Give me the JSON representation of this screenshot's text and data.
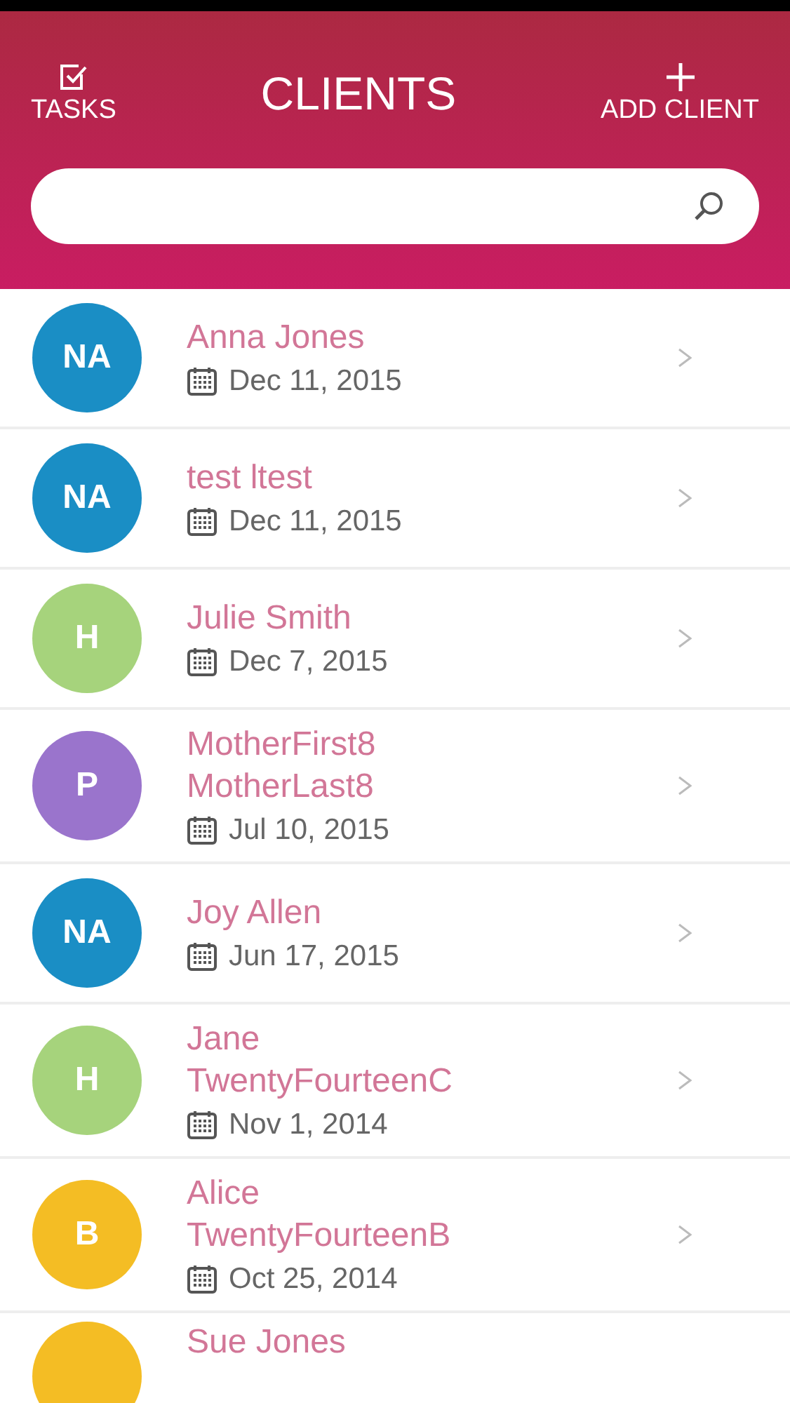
{
  "header": {
    "left_action": "TASKS",
    "title": "CLIENTS",
    "right_action": "ADD CLIENT"
  },
  "clients": [
    {
      "initials": "NA",
      "color": "#1a8ec5",
      "name_lines": [
        "Anna Jones"
      ],
      "date": "Dec 11, 2015"
    },
    {
      "initials": "NA",
      "color": "#1a8ec5",
      "name_lines": [
        "test ltest"
      ],
      "date": "Dec 11, 2015"
    },
    {
      "initials": "H",
      "color": "#a6d37c",
      "name_lines": [
        "Julie Smith"
      ],
      "date": "Dec 7, 2015"
    },
    {
      "initials": "P",
      "color": "#9a74cc",
      "name_lines": [
        "MotherFirst8",
        "MotherLast8"
      ],
      "date": "Jul 10, 2015"
    },
    {
      "initials": "NA",
      "color": "#1a8ec5",
      "name_lines": [
        "Joy Allen"
      ],
      "date": "Jun 17, 2015"
    },
    {
      "initials": "H",
      "color": "#a6d37c",
      "name_lines": [
        "Jane",
        "TwentyFourteenC"
      ],
      "date": "Nov 1, 2014"
    },
    {
      "initials": "B",
      "color": "#f4bd24",
      "name_lines": [
        "Alice",
        "TwentyFourteenB"
      ],
      "date": "Oct 25, 2014"
    },
    {
      "color": "#f4bd24",
      "name_lines": [
        "Sue Jones"
      ]
    }
  ]
}
